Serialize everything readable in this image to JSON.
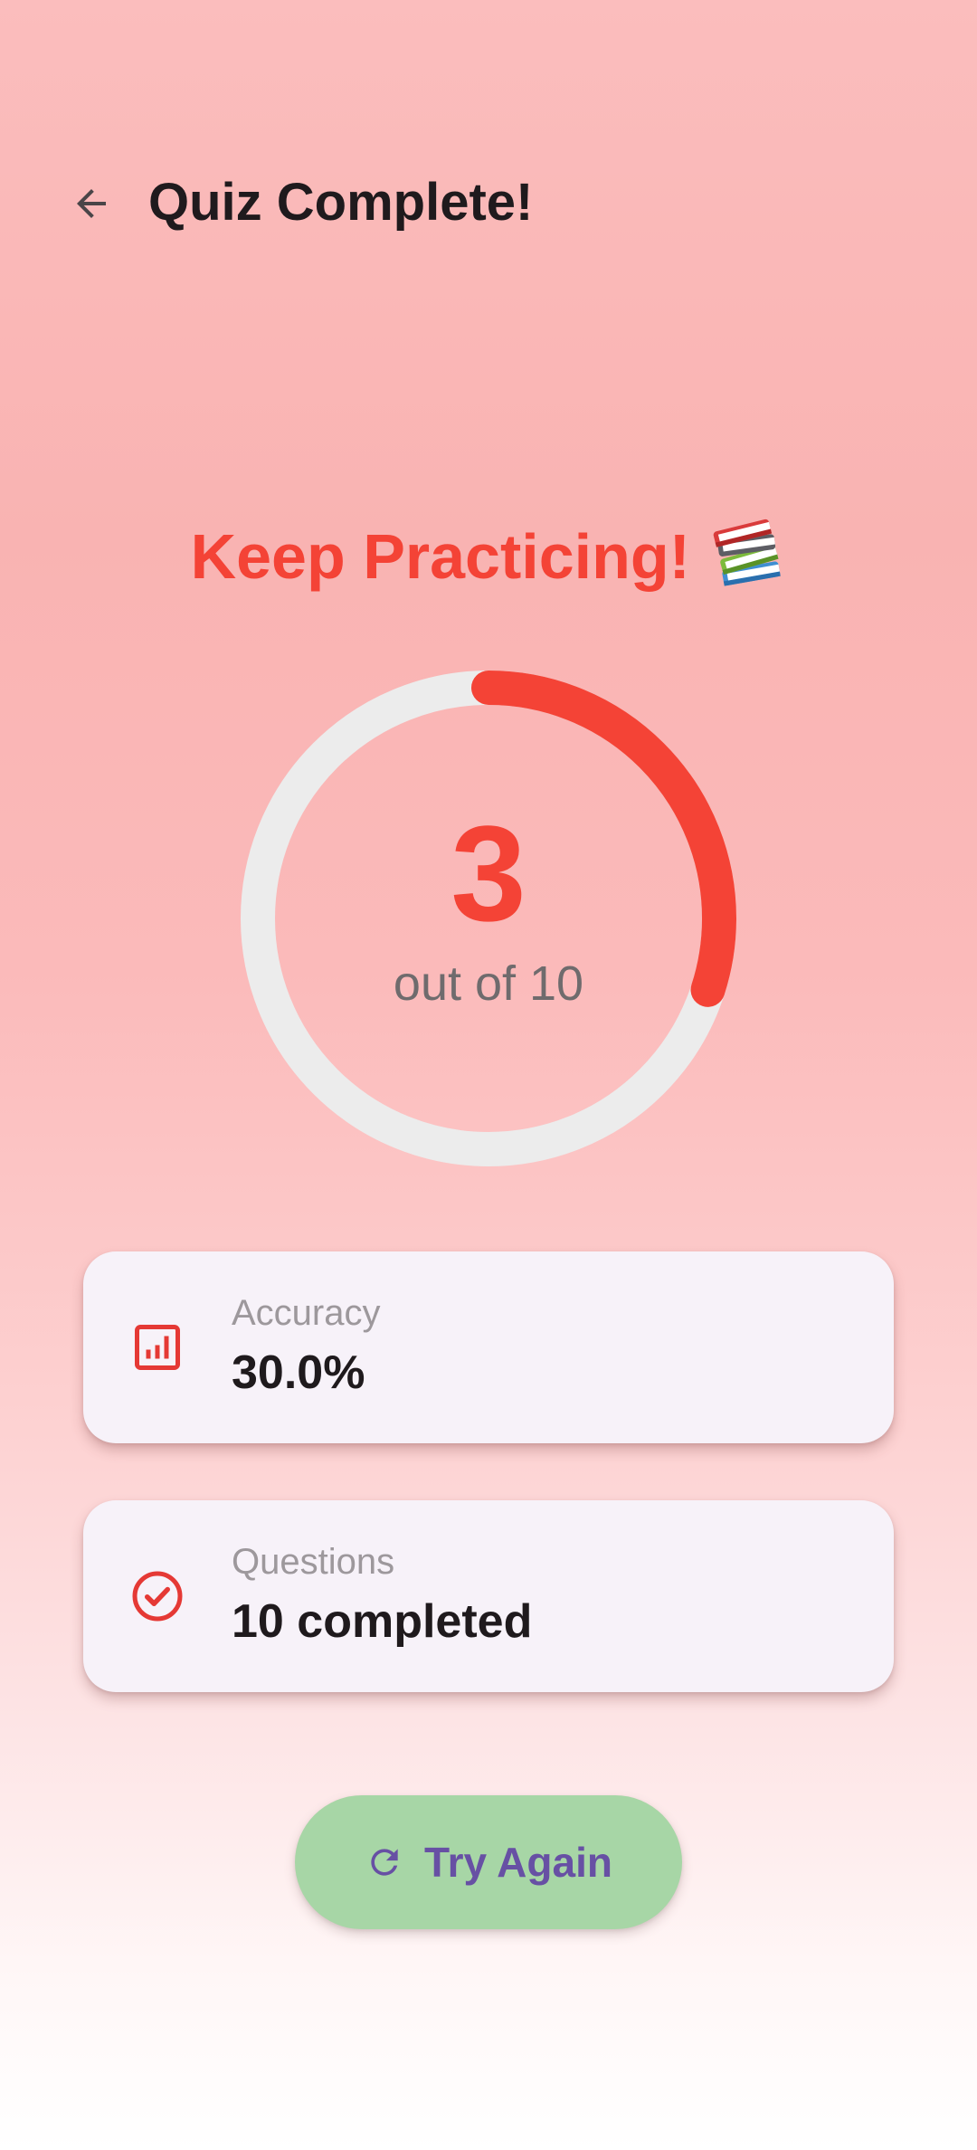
{
  "app_bar": {
    "title": "Quiz Complete!",
    "back_icon": "arrow-back-icon"
  },
  "result": {
    "headline": "Keep Practicing!",
    "headline_icon": "books-emoji-icon",
    "score": "3",
    "total_label": "out of 10",
    "progress_fraction": 0.3
  },
  "stats": [
    {
      "icon": "analytics-icon",
      "label": "Accuracy",
      "value": "30.0%"
    },
    {
      "icon": "check-circle-icon",
      "label": "Questions",
      "value": "10 completed"
    }
  ],
  "actions": {
    "try_again_label": "Try Again",
    "try_again_icon": "refresh-icon"
  },
  "colors": {
    "accent_red": "#f44336",
    "ring_track": "#ececec",
    "button_green": "#a7d6a6",
    "button_text": "#6750a4",
    "card_bg": "#f7f2f9"
  }
}
